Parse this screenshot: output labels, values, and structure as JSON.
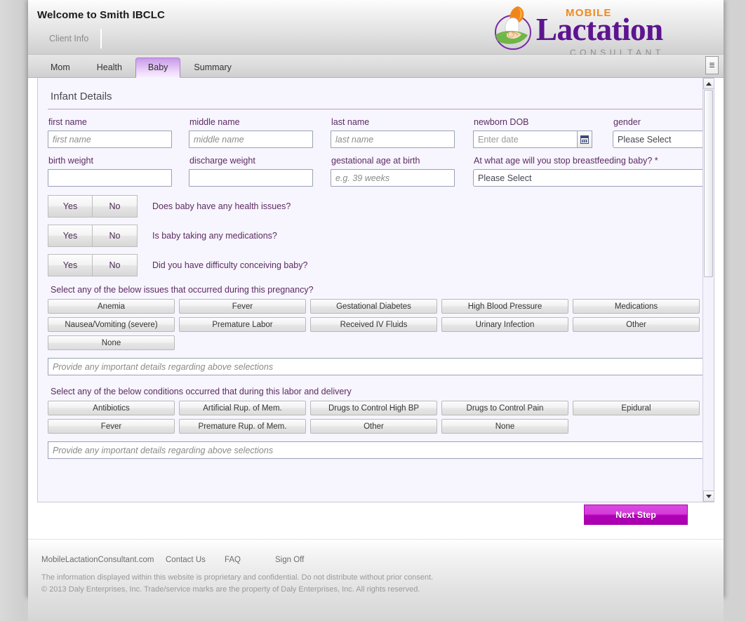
{
  "header": {
    "welcome_title": "Welcome to Smith IBCLC",
    "client_tab": "Client Info",
    "logo": {
      "mobile": "MOBILE",
      "lactation": "Lactation",
      "consultant": "CONSULTANT",
      "mark_icon": "mother-and-baby-icon"
    }
  },
  "tabs": [
    {
      "label": "Mom",
      "active": false
    },
    {
      "label": "Health",
      "active": false
    },
    {
      "label": "Baby",
      "active": true
    },
    {
      "label": "Summary",
      "active": false
    }
  ],
  "tab_overflow_icon": "chevron-down-icon",
  "form": {
    "section_title": "Infant Details",
    "fields": {
      "first_name": {
        "label": "first name",
        "placeholder": "first name",
        "value": ""
      },
      "middle_name": {
        "label": "middle name",
        "placeholder": "middle name",
        "value": ""
      },
      "last_name": {
        "label": "last name",
        "placeholder": "last name",
        "value": ""
      },
      "newborn_dob": {
        "label": "newborn DOB",
        "placeholder": "Enter date",
        "value": "",
        "icon": "calendar-icon"
      },
      "gender": {
        "label": "gender",
        "value": "Please Select",
        "caret": "▼"
      },
      "birth_weight": {
        "label": "birth weight",
        "placeholder": "",
        "value": ""
      },
      "discharge_weight": {
        "label": "discharge weight",
        "placeholder": "",
        "value": ""
      },
      "gestational_age": {
        "label": "gestational age at birth",
        "placeholder": "e.g. 39 weeks",
        "value": ""
      },
      "stop_breastfeeding": {
        "label": "At what age will you stop breastfeeding baby? *",
        "value": "Please Select",
        "caret": "▼"
      }
    },
    "yes_no": {
      "yes_label": "Yes",
      "no_label": "No",
      "questions": [
        "Does baby have any health issues?",
        "Is baby taking any medications?",
        "Did you have difficulty conceiving baby?"
      ]
    },
    "pregnancy": {
      "prompt": "Select any of the below issues that occurred during this pregnancy?",
      "options": [
        "Anemia",
        "Fever",
        "Gestational Diabetes",
        "High Blood Pressure",
        "Medications",
        "Nausea/Vomiting (severe)",
        "Premature Labor",
        "Received IV Fluids",
        "Urinary Infection",
        "Other",
        "None"
      ],
      "note_placeholder": "Provide any important details regarding above selections",
      "note_value": ""
    },
    "labor": {
      "prompt": "Select any of the below conditions occurred that during this labor and delivery",
      "options": [
        "Antibiotics",
        "Artificial Rup. of Mem.",
        "Drugs to Control High BP",
        "Drugs to Control Pain",
        "Epidural",
        "Fever",
        "Premature Rup. of Mem.",
        "Other",
        "None"
      ],
      "note_placeholder": "Provide any important details regarding above selections",
      "note_value": ""
    }
  },
  "actions": {
    "next_step": "Next Step"
  },
  "footer": {
    "links": [
      "MobileLactationConsultant.com",
      "Contact Us",
      "FAQ",
      "Sign Off"
    ],
    "legal": [
      "The information displayed within this website is proprietary and confidential. Do not distribute without prior consent.",
      "© 2013   Daly Enterprises, Inc. Trade/service marks are the property of Daly Enterprises, Inc. All rights reserved."
    ]
  },
  "colors": {
    "accent_purple": "#5c2b63",
    "tab_active": "#c79be8",
    "next_step": "#b200b8",
    "logo_orange": "#f08a1c",
    "logo_purple": "#5d1490"
  }
}
